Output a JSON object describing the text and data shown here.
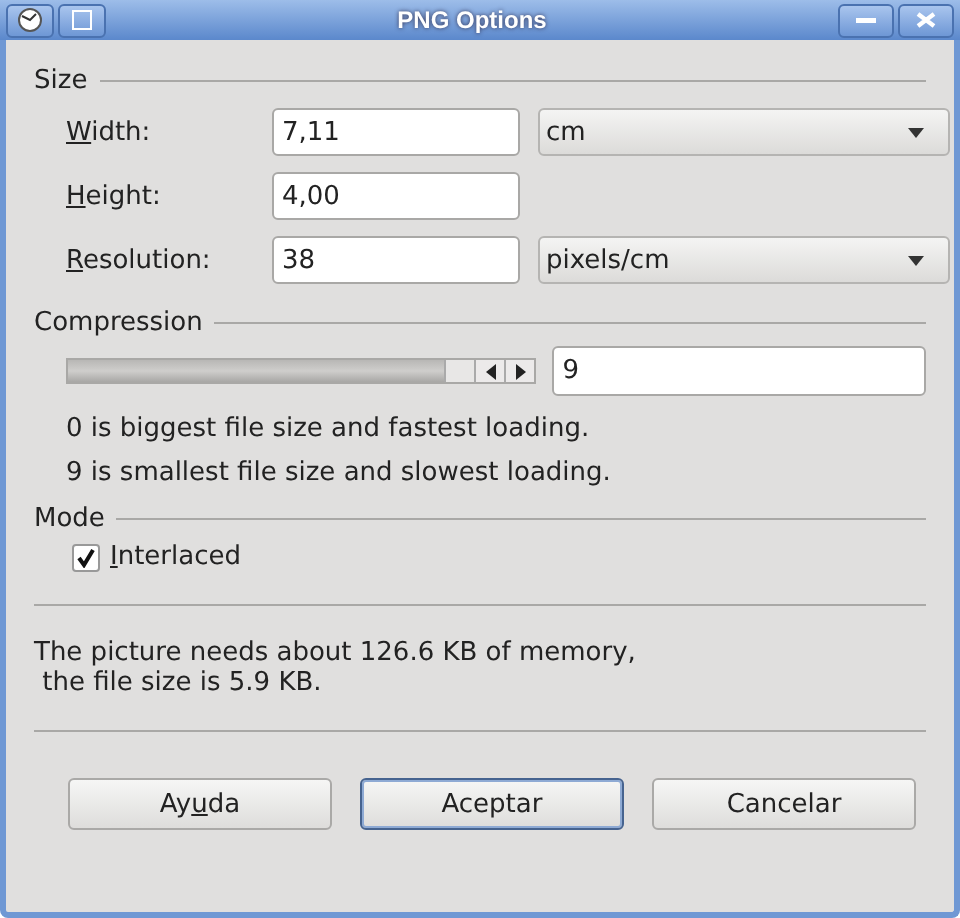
{
  "window": {
    "title": "PNG Options"
  },
  "size": {
    "title": "Size",
    "rows": [
      {
        "label": {
          "key": "W",
          "after": "idth:"
        },
        "value": "7,11",
        "unit": "cm"
      },
      {
        "label": {
          "key": "H",
          "after": "eight:"
        },
        "value": "4,00"
      },
      {
        "label": {
          "key": "R",
          "after": "esolution:"
        },
        "value": "38",
        "unit": "pixels/cm"
      }
    ]
  },
  "compression": {
    "title": "Compression",
    "value": "9",
    "notes": [
      "0 is biggest file size and fastest loading.",
      "9 is smallest file size and slowest loading."
    ]
  },
  "mode": {
    "title": "Mode",
    "checkbox": {
      "label": {
        "key": "I",
        "after": "nterlaced"
      },
      "checked": true
    }
  },
  "info": [
    "The picture needs about 126.6 KB of memory,",
    " the file size is 5.9 KB."
  ],
  "buttons": [
    {
      "label": {
        "before": "Ay",
        "key": "u",
        "after": "da"
      },
      "default": false
    },
    {
      "label": {
        "before": "Aceptar"
      },
      "default": true
    },
    {
      "label": {
        "before": "Cancelar"
      },
      "default": false
    }
  ]
}
